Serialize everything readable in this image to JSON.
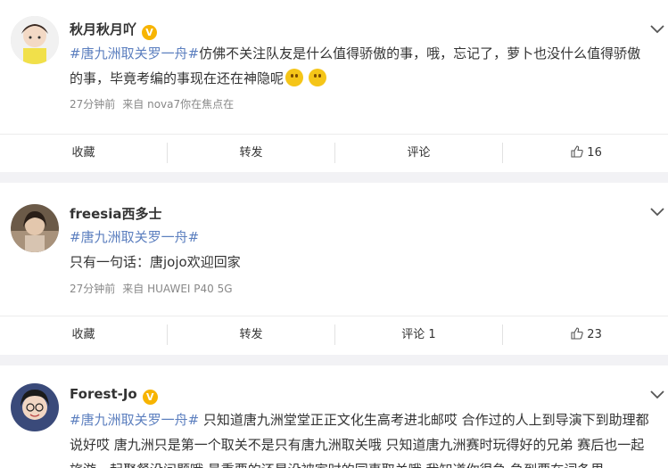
{
  "posts": [
    {
      "user": "秋月秋月吖",
      "verified": true,
      "text_tag": "#唐九洲取关罗一舟#",
      "text_body": "仿佛不关注队友是什么值得骄傲的事，哦，忘记了，萝卜也没什么值得骄傲的事，毕竟考编的事现在还在神隐呢",
      "time": "27分钟前",
      "source": "来自 nova7你在焦点在",
      "actions": {
        "fav": "收藏",
        "repost": "转发",
        "comment": "评论",
        "like_count": "16"
      }
    },
    {
      "user": "freesia西多士",
      "verified": false,
      "text_tag": "#唐九洲取关罗一舟#",
      "text_body": "只有一句话：唐jojo欢迎回家",
      "time": "27分钟前",
      "source": "来自 HUAWEI P40 5G",
      "actions": {
        "fav": "收藏",
        "repost": "转发",
        "comment": "评论 1",
        "like_count": "23"
      }
    },
    {
      "user": "Forest-Jo",
      "verified": true,
      "text_tag": "#唐九洲取关罗一舟#",
      "text_body": " 只知道唐九洲堂堂正正文化生高考进北邮哎 合作过的人上到导演下到助理都说好哎 唐九洲只是第一个取关不是只有唐九洲取关哦 只知道唐九洲赛时玩得好的兄弟 赛后也一起旅游一起聚餐没问题哦 最重要的还是没被家时的同事取关哦 我知道你很急 急到要在词条里"
    }
  ],
  "colors": {
    "tag": "#5c7fbf",
    "verified": "#f7b400"
  }
}
